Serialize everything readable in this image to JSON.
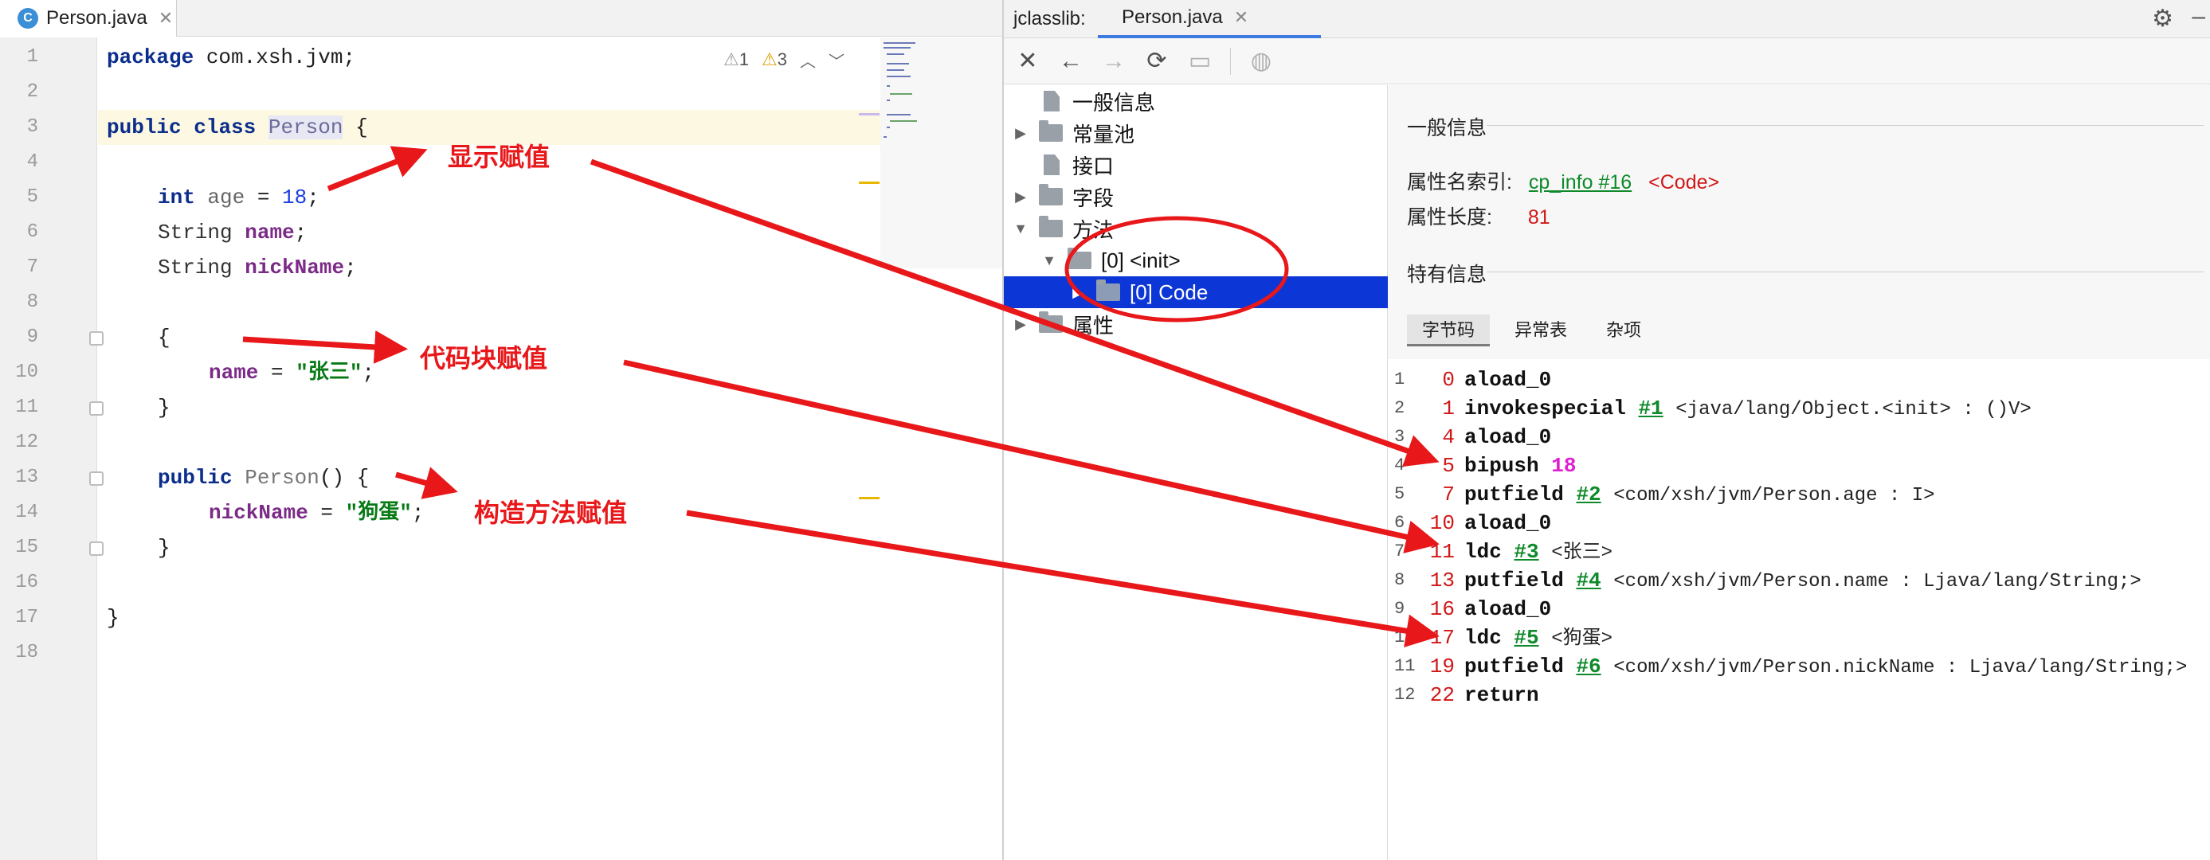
{
  "editor": {
    "tab_label": "Person.java",
    "tab_icon": "C",
    "inspection": {
      "warnings": "1",
      "weak_warnings": "3"
    },
    "line_numbers": [
      "1",
      "2",
      "3",
      "4",
      "5",
      "6",
      "7",
      "8",
      "9",
      "10",
      "11",
      "12",
      "13",
      "14",
      "15",
      "16",
      "17",
      "18"
    ],
    "code": {
      "l1_kw": "package",
      "l1_rest": " com.xsh.jvm;",
      "l3_kw1": "public",
      "l3_kw2": "class",
      "l3_name": "Person",
      "l3_rest": " {",
      "l5_type": "int",
      "l5_name": "age",
      "l5_eq": " = ",
      "l5_num": "18",
      "l5_end": ";",
      "l6_type": "String",
      "l6_name": "name",
      "l6_end": ";",
      "l7_type": "String",
      "l7_name": "nickName",
      "l7_end": ";",
      "l9": "{",
      "l10_name": "name",
      "l10_eq": " = ",
      "l10_str": "\"张三\"",
      "l10_end": ";",
      "l11": "}",
      "l13_kw": "public",
      "l13_name": "Person",
      "l13_rest": "() {",
      "l14_name": "nickName",
      "l14_eq": " = ",
      "l14_str": "\"狗蛋\"",
      "l14_end": ";",
      "l15": "}",
      "l17": "}"
    }
  },
  "jclasslib": {
    "tool_title": "jclasslib:",
    "tab_label": "Person.java",
    "tree": {
      "general": "一般信息",
      "constant_pool": "常量池",
      "interfaces": "接口",
      "fields": "字段",
      "methods": "方法",
      "method_init": "[0] <init>",
      "code": "[0] Code",
      "attributes": "属性"
    },
    "detail": {
      "general_title": "一般信息",
      "attr_name_index_label": "属性名索引:",
      "attr_name_index_link": "cp_info #16",
      "attr_name_index_value": "<Code>",
      "attr_length_label": "属性长度:",
      "attr_length_value": "81",
      "specific_title": "特有信息",
      "tabs": [
        "字节码",
        "异常表",
        "杂项"
      ]
    },
    "bytecode": [
      {
        "idx": "1",
        "off": "0",
        "ins": "aload_0",
        "arg": "",
        "ref": "",
        "num": ""
      },
      {
        "idx": "2",
        "off": "1",
        "ins": "invokespecial",
        "arg": "#1",
        "ref": "<java/lang/Object.<init> : ()V>",
        "num": ""
      },
      {
        "idx": "3",
        "off": "4",
        "ins": "aload_0",
        "arg": "",
        "ref": "",
        "num": ""
      },
      {
        "idx": "4",
        "off": "5",
        "ins": "bipush",
        "arg": "",
        "ref": "",
        "num": "18"
      },
      {
        "idx": "5",
        "off": "7",
        "ins": "putfield",
        "arg": "#2",
        "ref": "<com/xsh/jvm/Person.age : I>",
        "num": ""
      },
      {
        "idx": "6",
        "off": "10",
        "ins": "aload_0",
        "arg": "",
        "ref": "",
        "num": ""
      },
      {
        "idx": "7",
        "off": "11",
        "ins": "ldc",
        "arg": "#3",
        "ref": "<张三>",
        "num": ""
      },
      {
        "idx": "8",
        "off": "13",
        "ins": "putfield",
        "arg": "#4",
        "ref": "<com/xsh/jvm/Person.name : Ljava/lang/String;>",
        "num": ""
      },
      {
        "idx": "9",
        "off": "16",
        "ins": "aload_0",
        "arg": "",
        "ref": "",
        "num": ""
      },
      {
        "idx": "10",
        "off": "17",
        "ins": "ldc",
        "arg": "#5",
        "ref": "<狗蛋>",
        "num": ""
      },
      {
        "idx": "11",
        "off": "19",
        "ins": "putfield",
        "arg": "#6",
        "ref": "<com/xsh/jvm/Person.nickName : Ljava/lang/String;>",
        "num": ""
      },
      {
        "idx": "12",
        "off": "22",
        "ins": "return",
        "arg": "",
        "ref": "",
        "num": ""
      }
    ]
  },
  "annotations": {
    "explicit": "显示赋值",
    "block": "代码块赋值",
    "constructor": "构造方法赋值"
  },
  "colors": {
    "annotation_red": "#e8171a",
    "selection_blue": "#0d36d6",
    "link_green": "#0f8a2a"
  }
}
